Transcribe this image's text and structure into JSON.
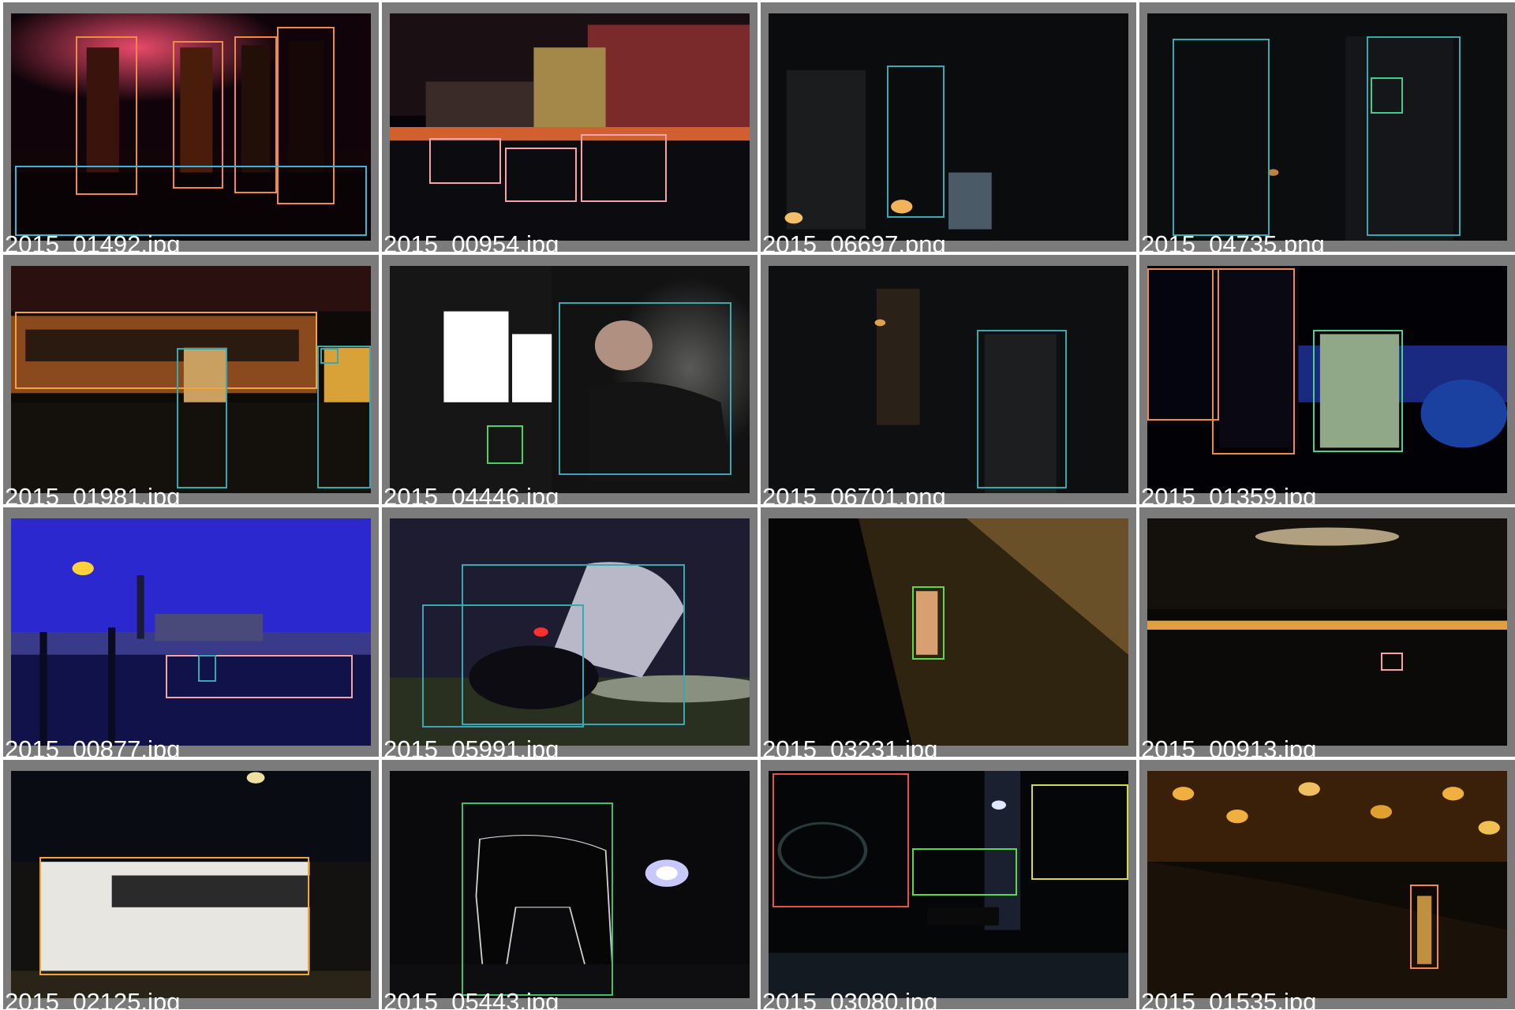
{
  "title": "",
  "tiles": [
    {
      "filename": "2015_01492.jpg",
      "scene": "bar-bottles",
      "boxes": [
        {
          "color": "#f08a4b"
        },
        {
          "color": "#f08a4b"
        },
        {
          "color": "#f08a4b"
        },
        {
          "color": "#f08a4b"
        },
        {
          "color": "#3eb3d6"
        }
      ]
    },
    {
      "filename": "2015_00954.jpg",
      "scene": "harbor-night",
      "boxes": [
        {
          "color": "#f4a3a8"
        },
        {
          "color": "#f4a3a8"
        },
        {
          "color": "#f4a3a8"
        }
      ]
    },
    {
      "filename": "2015_06697.png",
      "scene": "dark-candle-room",
      "boxes": [
        {
          "color": "#3aa7b2"
        }
      ]
    },
    {
      "filename": "2015_04735.png",
      "scene": "dark-figures",
      "boxes": [
        {
          "color": "#3aa7b2"
        },
        {
          "color": "#3aa7b2"
        },
        {
          "color": "#3fce88"
        }
      ]
    },
    {
      "filename": "2015_01981.jpg",
      "scene": "bus-street",
      "boxes": [
        {
          "color": "#f2a33a"
        },
        {
          "color": "#3aa7b2"
        },
        {
          "color": "#3aa7b2"
        },
        {
          "color": "#3aa7b2"
        }
      ]
    },
    {
      "filename": "2015_04446.jpg",
      "scene": "computer-desk",
      "boxes": [
        {
          "color": "#3aa7b2"
        },
        {
          "color": "#4ccf63"
        }
      ]
    },
    {
      "filename": "2015_06701.png",
      "scene": "dark-library",
      "boxes": [
        {
          "color": "#3aa7b2"
        }
      ]
    },
    {
      "filename": "2015_01359.jpg",
      "scene": "bottles-glass",
      "boxes": [
        {
          "color": "#f08a4b"
        },
        {
          "color": "#f08a4b"
        },
        {
          "color": "#4ccf8a"
        }
      ]
    },
    {
      "filename": "2015_00877.jpg",
      "scene": "venice-blue",
      "boxes": [
        {
          "color": "#f4a3a8"
        },
        {
          "color": "#3aa7b2"
        }
      ]
    },
    {
      "filename": "2015_05991.jpg",
      "scene": "motorbike",
      "boxes": [
        {
          "color": "#3aa7b2"
        },
        {
          "color": "#3aa7b2"
        }
      ]
    },
    {
      "filename": "2015_03231.jpg",
      "scene": "cobblestone-cat",
      "boxes": [
        {
          "color": "#5ed84a"
        }
      ]
    },
    {
      "filename": "2015_00913.jpg",
      "scene": "city-lights-water",
      "boxes": [
        {
          "color": "#f4a3a8"
        }
      ]
    },
    {
      "filename": "2015_02125.jpg",
      "scene": "white-bus",
      "boxes": [
        {
          "color": "#f2a33a"
        }
      ]
    },
    {
      "filename": "2015_05443.jpg",
      "scene": "wolf-silhouette",
      "boxes": [
        {
          "color": "#3cc06a"
        }
      ]
    },
    {
      "filename": "2015_03080.jpg",
      "scene": "bicycle-cat-alley",
      "boxes": [
        {
          "color": "#e8504a"
        },
        {
          "color": "#5ed84a"
        },
        {
          "color": "#d8d84a"
        }
      ]
    },
    {
      "filename": "2015_01535.jpg",
      "scene": "bokeh-bottle",
      "boxes": [
        {
          "color": "#f08a4b"
        }
      ]
    }
  ]
}
